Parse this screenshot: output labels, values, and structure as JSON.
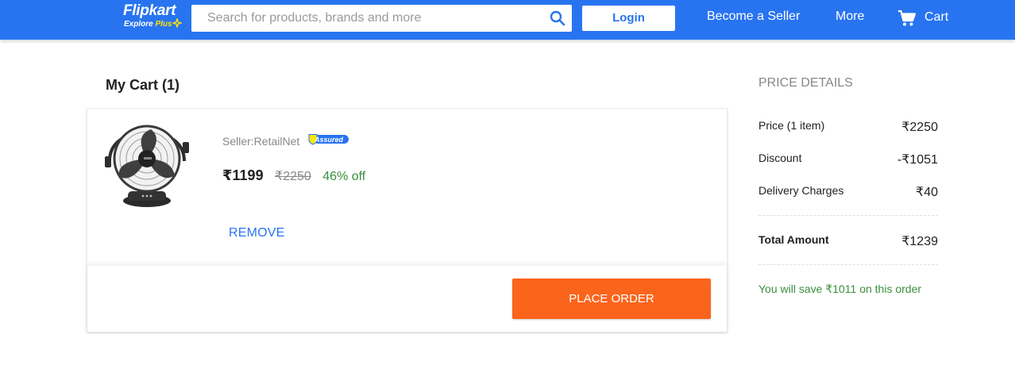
{
  "header": {
    "logo_name": "Flipkart",
    "logo_tag_explore": "Explore",
    "logo_tag_plus": "Plus",
    "search_placeholder": "Search for products, brands and more",
    "login_label": "Login",
    "become_seller_label": "Become a Seller",
    "more_label": "More",
    "cart_label": "Cart",
    "icons": [
      "search-icon",
      "cart-icon",
      "plus-star-icon"
    ],
    "colors": {
      "brand": "#2874f0",
      "accent": "#ffe500"
    }
  },
  "cart": {
    "title": "My Cart (1)",
    "items": [
      {
        "seller": "Seller:RetailNet",
        "assured_badge": "Assured",
        "price": "₹1199",
        "original_price": "₹2250",
        "discount": "46% off",
        "remove_label": "REMOVE"
      }
    ],
    "place_order_label": "PLACE ORDER",
    "colors": {
      "place_order": "#fb641b",
      "discount": "#388e3c"
    }
  },
  "price_details": {
    "title": "PRICE DETAILS",
    "rows": [
      {
        "label": "Price (1 item)",
        "value": "₹2250"
      },
      {
        "label": "Discount",
        "value": "-₹1051"
      },
      {
        "label": "Delivery Charges",
        "value": "₹40"
      }
    ],
    "total_label": "Total Amount",
    "total_value": "₹1239",
    "savings_text": "You will save ₹1011 on this order"
  }
}
